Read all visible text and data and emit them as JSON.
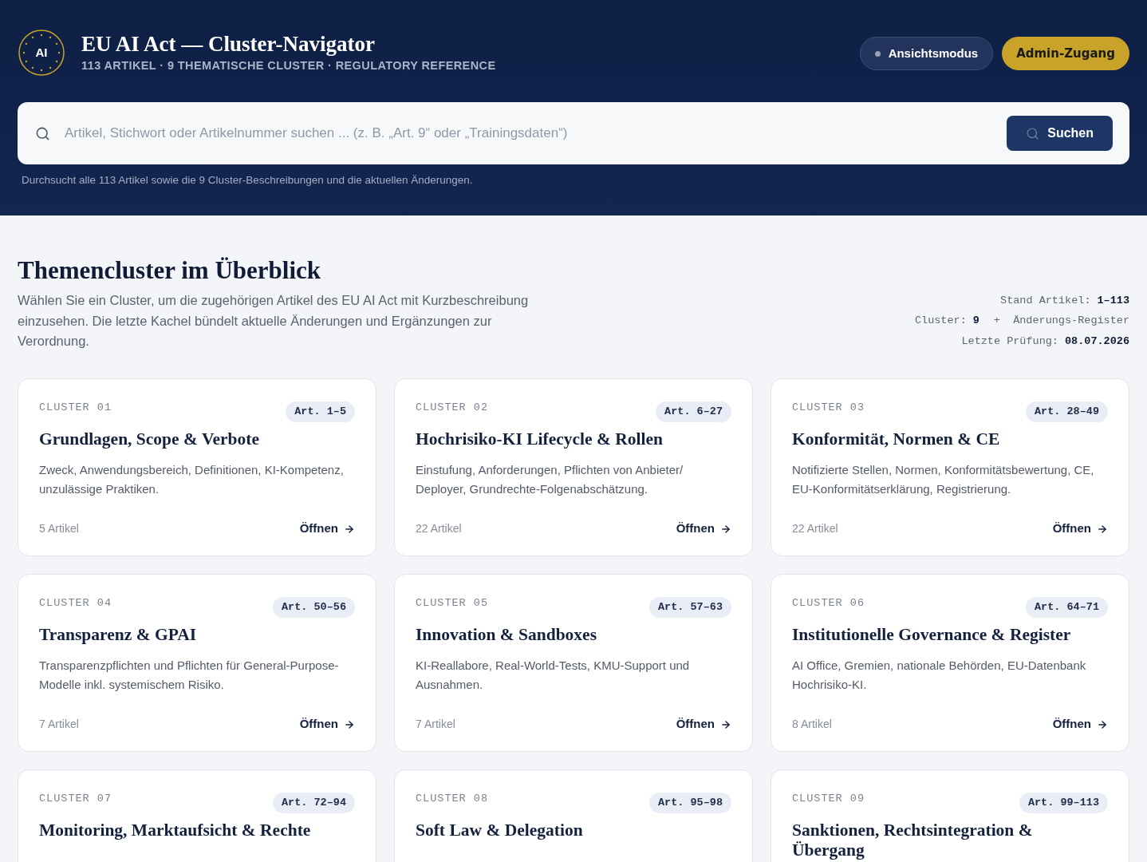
{
  "header": {
    "logo": "AI",
    "title": "EU AI Act — Cluster-Navigator",
    "subtitle": "113 ARTIKEL · 9 THEMATISCHE CLUSTER · REGULATORY REFERENCE",
    "mode_button": "Ansichtsmodus",
    "admin_button": "Admin-Zugang"
  },
  "search": {
    "placeholder": "Artikel, Stichwort oder Artikelnummer suchen ... (z. B. „Art. 9“ oder „Trainingsdaten“)",
    "button": "Suchen",
    "hint": "Durchsucht alle 113 Artikel sowie die 9 Cluster-Beschreibungen und die aktuellen Änderungen."
  },
  "overview": {
    "title": "Themencluster im Überblick",
    "description": "Wählen Sie ein Cluster, um die zugehörigen Artikel des EU AI Act mit Kurzbeschreibung einzusehen. Die letzte Kachel bündelt aktuelle Änderungen und Ergänzungen zur Verordnung.",
    "meta": [
      {
        "label": "Stand Artikel:",
        "value": "1–113"
      },
      {
        "label": "Cluster:",
        "value": "9",
        "suffix": "+  Änderungs-Register"
      },
      {
        "label": "Letzte Prüfung:",
        "value": "08.07.2026"
      }
    ]
  },
  "clusters": [
    {
      "label": "CLUSTER 01",
      "range": "Art. 1–5",
      "title": "Grundlagen, Scope & Verbote",
      "description": "Zweck, Anwendungsbereich, Definitionen, KI-Kompetenz, unzulässige Praktiken.",
      "count": "5 Artikel",
      "action": "Öffnen"
    },
    {
      "label": "CLUSTER 02",
      "range": "Art. 6–27",
      "title": "Hochrisiko-KI Lifecycle & Rollen",
      "description": "Einstufung, Anforderungen, Pflichten von Anbieter/ Deployer, Grundrechte-Folgenabschätzung.",
      "count": "22 Artikel",
      "action": "Öffnen"
    },
    {
      "label": "CLUSTER 03",
      "range": "Art. 28–49",
      "title": "Konformität, Normen & CE",
      "description": "Notifizierte Stellen, Normen, Konformitätsbewertung, CE, EU-Konformitätserklärung, Registrierung.",
      "count": "22 Artikel",
      "action": "Öffnen"
    },
    {
      "label": "CLUSTER 04",
      "range": "Art. 50–56",
      "title": "Transparenz & GPAI",
      "description": "Transparenzpflichten und Pflichten für General-Purpose-Modelle inkl. systemischem Risiko.",
      "count": "7 Artikel",
      "action": "Öffnen"
    },
    {
      "label": "CLUSTER 05",
      "range": "Art. 57–63",
      "title": "Innovation & Sandboxes",
      "description": "KI-Reallabore, Real-World-Tests, KMU-Support und Ausnahmen.",
      "count": "7 Artikel",
      "action": "Öffnen"
    },
    {
      "label": "CLUSTER 06",
      "range": "Art. 64–71",
      "title": "Institutionelle Governance & Register",
      "description": "AI Office, Gremien, nationale Behörden, EU-Datenbank Hochrisiko-KI.",
      "count": "8 Artikel",
      "action": "Öffnen"
    },
    {
      "label": "CLUSTER 07",
      "range": "Art. 72–94",
      "title": "Monitoring, Marktaufsicht & Rechte"
    },
    {
      "label": "CLUSTER 08",
      "range": "Art. 95–98",
      "title": "Soft Law & Delegation"
    },
    {
      "label": "CLUSTER 09",
      "range": "Art. 99–113",
      "title": "Sanktionen, Rechtsintegration & Übergang"
    }
  ]
}
